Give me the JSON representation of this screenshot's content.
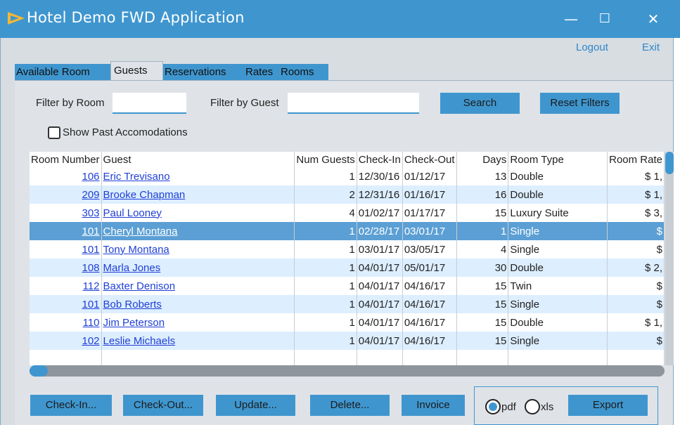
{
  "window": {
    "title": "Hotel Demo FWD Application",
    "minimize": "—",
    "maximize": "☐",
    "close": "✕"
  },
  "header": {
    "logout": "Logout",
    "exit": "Exit"
  },
  "tabs": [
    {
      "label": "Available Room",
      "active": false
    },
    {
      "label": "Guests",
      "active": true
    },
    {
      "label": "Reservations",
      "active": false
    },
    {
      "label": "Rates",
      "active": false
    },
    {
      "label": "Rooms",
      "active": false
    }
  ],
  "filters": {
    "room_label": "Filter by Room",
    "room_value": "",
    "guest_label": "Filter by Guest",
    "guest_value": "",
    "search": "Search",
    "reset": "Reset Filters",
    "show_past_label": "Show Past Accomodations",
    "show_past_checked": false
  },
  "table": {
    "columns": [
      "Room Number",
      "Guest",
      "Num Guests",
      "Check-In",
      "Check-Out",
      "Days",
      "Room Type",
      "Room Rate"
    ],
    "rows": [
      [
        "106",
        "Eric Trevisano",
        "1",
        "12/30/16",
        "01/12/17",
        "13",
        "Double",
        "$ 1,"
      ],
      [
        "209",
        "Brooke Chapman",
        "2",
        "12/31/16",
        "01/16/17",
        "16",
        "Double",
        "$ 1,"
      ],
      [
        "303",
        "Paul Looney",
        "4",
        "01/02/17",
        "01/17/17",
        "15",
        "Luxury Suite",
        "$ 3,"
      ],
      [
        "101",
        "Cheryl Montana",
        "1",
        "02/28/17",
        "03/01/17",
        "1",
        "Single",
        "$"
      ],
      [
        "101",
        "Tony Montana",
        "1",
        "03/01/17",
        "03/05/17",
        "4",
        "Single",
        "$"
      ],
      [
        "108",
        "Marla Jones",
        "1",
        "04/01/17",
        "05/01/17",
        "30",
        "Double",
        "$ 2,"
      ],
      [
        "112",
        "Baxter Denison",
        "1",
        "04/01/17",
        "04/16/17",
        "15",
        "Twin",
        "$"
      ],
      [
        "101",
        "Bob Roberts",
        "1",
        "04/01/17",
        "04/16/17",
        "15",
        "Single",
        "$"
      ],
      [
        "110",
        "Jim Peterson",
        "1",
        "04/01/17",
        "04/16/17",
        "15",
        "Double",
        "$ 1,"
      ],
      [
        "102",
        "Leslie Michaels",
        "1",
        "04/01/17",
        "04/16/17",
        "15",
        "Single",
        "$"
      ]
    ],
    "selected_row": 3
  },
  "actions": {
    "checkin": "Check-In...",
    "checkout": "Check-Out...",
    "update": "Update...",
    "delete": "Delete...",
    "invoice": "Invoice"
  },
  "export": {
    "pdf_label": "pdf",
    "xls_label": "xls",
    "selected": "pdf",
    "button": "Export"
  },
  "colors": {
    "accent": "#3f96cf",
    "selection": "#5b9fd4",
    "alt_row": "#ddeeff",
    "link": "#1f3fd6"
  },
  "icons": {
    "app": "play-arrow-icon"
  }
}
